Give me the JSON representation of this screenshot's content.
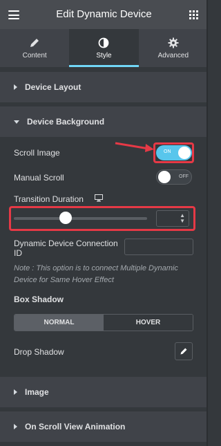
{
  "header": {
    "title": "Edit Dynamic Device",
    "menu_icon": "hamburger-icon",
    "apps_icon": "grid-icon"
  },
  "tabs": [
    {
      "label": "Content",
      "icon": "pencil-icon",
      "active": false
    },
    {
      "label": "Style",
      "icon": "half-circle-icon",
      "active": true
    },
    {
      "label": "Advanced",
      "icon": "gear-icon",
      "active": false
    }
  ],
  "sections": {
    "device_layout": "Device Layout",
    "device_background": "Device Background",
    "image": "Image",
    "on_scroll_view_animation": "On Scroll View Animation"
  },
  "controls": {
    "scroll_image": {
      "label": "Scroll Image",
      "state": "ON"
    },
    "manual_scroll": {
      "label": "Manual Scroll",
      "state": "OFF"
    },
    "transition_duration": {
      "label": "Transition Duration",
      "slider_fraction": 0.39,
      "value": ""
    },
    "connection_id": {
      "label_line1": "Dynamic Device Connection",
      "label_line2": "ID",
      "value": ""
    },
    "note": "Note : This option is to connect Multiple Dynamic Device for Same Hover Effect",
    "box_shadow": {
      "label": "Box Shadow",
      "normal": "NORMAL",
      "hover": "HOVER",
      "active": "NORMAL"
    },
    "drop_shadow": {
      "label": "Drop Shadow"
    }
  },
  "colors": {
    "accent": "#71d7f7",
    "toggle_on": "#58c6ec",
    "highlight": "#e63946"
  }
}
